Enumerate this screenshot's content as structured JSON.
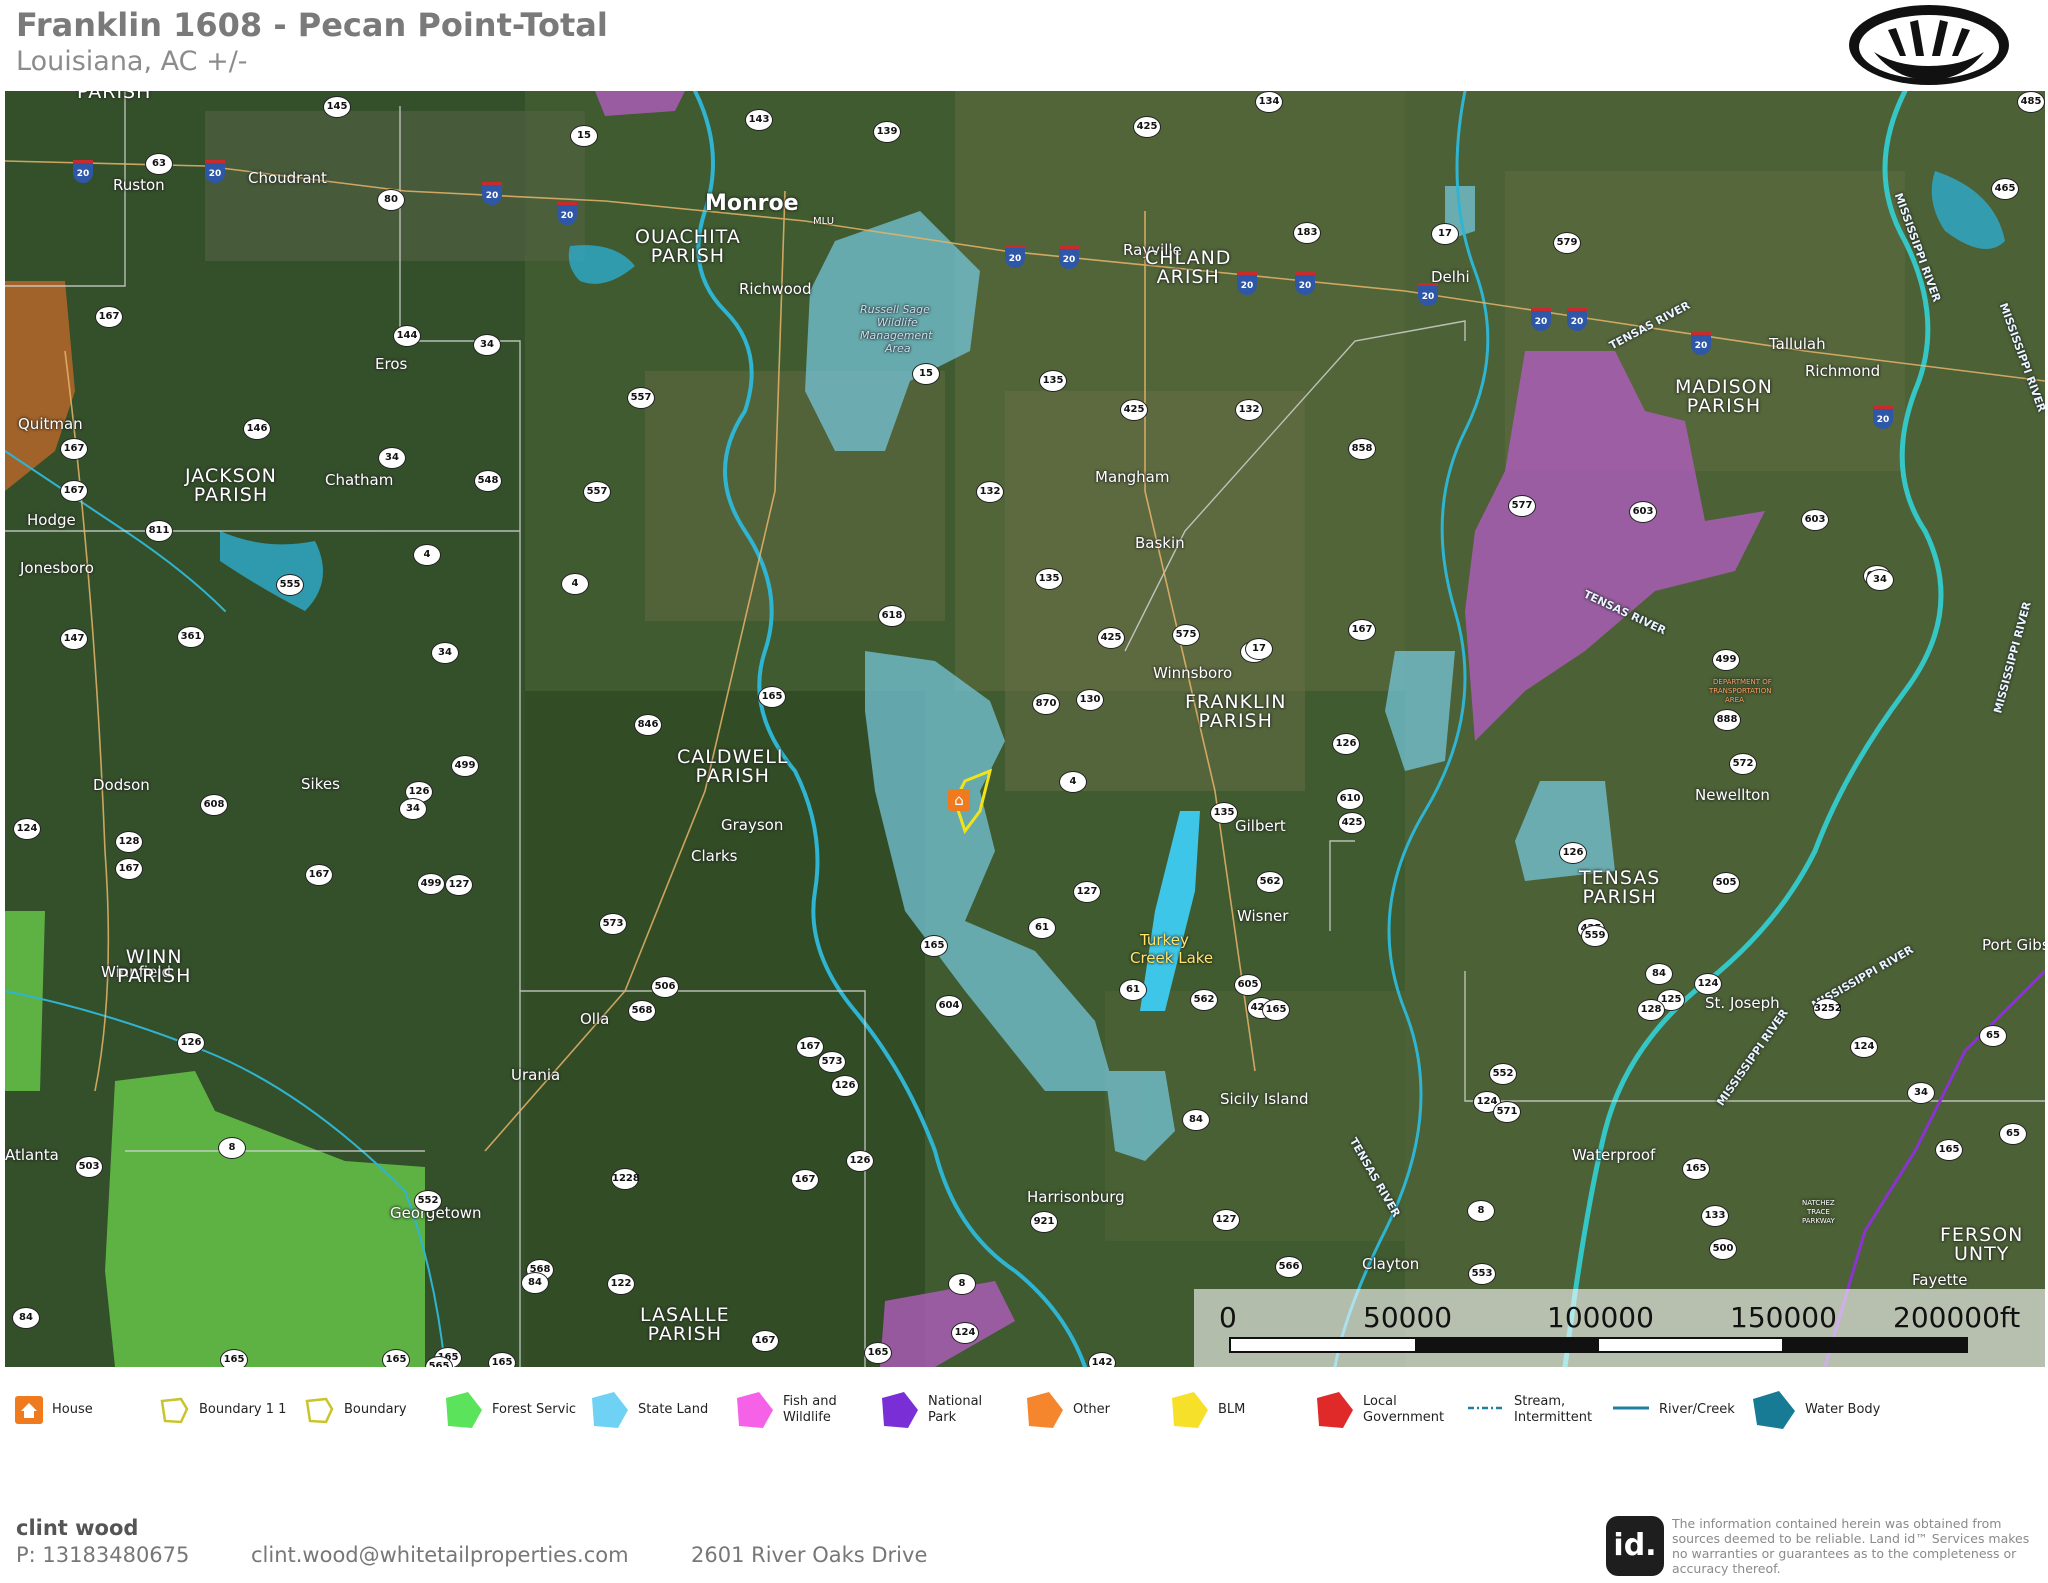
{
  "header": {
    "title": "Franklin 1608 - Pecan Point-Total",
    "subtitle": "Louisiana,  AC +/-"
  },
  "logo": {
    "icon": "bear-paw-logo-icon"
  },
  "map": {
    "property_marker": {
      "icon": "house-icon"
    },
    "cities": [
      {
        "name": "Ruston",
        "size": "small"
      },
      {
        "name": "Choudrant",
        "size": "small"
      },
      {
        "name": "Monroe",
        "size": "big"
      },
      {
        "name": "Richwood",
        "size": "small"
      },
      {
        "name": "Rayville",
        "size": "small"
      },
      {
        "name": "Delhi",
        "size": "small"
      },
      {
        "name": "Tallulah",
        "size": "small"
      },
      {
        "name": "Richmond",
        "size": "small"
      },
      {
        "name": "Eros",
        "size": "small"
      },
      {
        "name": "Quitman",
        "size": "small"
      },
      {
        "name": "Chatham",
        "size": "small"
      },
      {
        "name": "Hodge",
        "size": "small"
      },
      {
        "name": "Jonesboro",
        "size": "small"
      },
      {
        "name": "Mangham",
        "size": "small"
      },
      {
        "name": "Baskin",
        "size": "small"
      },
      {
        "name": "Winnsboro",
        "size": "small"
      },
      {
        "name": "Dodson",
        "size": "small"
      },
      {
        "name": "Sikes",
        "size": "small"
      },
      {
        "name": "Grayson",
        "size": "small"
      },
      {
        "name": "Clarks",
        "size": "small"
      },
      {
        "name": "Gilbert",
        "size": "small"
      },
      {
        "name": "Newellton",
        "size": "small"
      },
      {
        "name": "Wisner",
        "size": "small"
      },
      {
        "name": "Winnfield",
        "size": "small"
      },
      {
        "name": "Olla",
        "size": "small"
      },
      {
        "name": "Urania",
        "size": "small"
      },
      {
        "name": "St. Joseph",
        "size": "small"
      },
      {
        "name": "Port Gibs",
        "size": "small"
      },
      {
        "name": "Sicily Island",
        "size": "small"
      },
      {
        "name": "Atlanta",
        "size": "small"
      },
      {
        "name": "Waterproof",
        "size": "small"
      },
      {
        "name": "Georgetown",
        "size": "small"
      },
      {
        "name": "Harrisonburg",
        "size": "small"
      },
      {
        "name": "Clayton",
        "size": "small"
      },
      {
        "name": "Fayette",
        "size": "small"
      }
    ],
    "parishes": [
      {
        "line1": "OUACHITA",
        "line2": "PARISH"
      },
      {
        "line1": "CHLAND",
        "line2": "ARISH"
      },
      {
        "line1": "MADISON",
        "line2": "PARISH"
      },
      {
        "line1": "JACKSON",
        "line2": "PARISH"
      },
      {
        "line1": "FRANKLIN",
        "line2": "PARISH"
      },
      {
        "line1": "CALDWELL",
        "line2": "PARISH"
      },
      {
        "line1": "TENSAS",
        "line2": "PARISH"
      },
      {
        "line1": "WINN",
        "line2": "PARISH"
      },
      {
        "line1": "LASALLE",
        "line2": "PARISH"
      },
      {
        "line1": "FERSON",
        "line2": "UNTY"
      },
      {
        "line1": "PARISH",
        "line2": ""
      }
    ],
    "rivers": [
      {
        "name": "TENSAS RIVER"
      },
      {
        "name": "TENSAS RIVER"
      },
      {
        "name": "MISSISSIPPI RIVER"
      },
      {
        "name": "MISSISSIPPI RIVER"
      },
      {
        "name": "MISSISSIPPI RIVER"
      },
      {
        "name": "MISSISSIPPI RIVER"
      },
      {
        "name": "MISSISSIPPI RIVER"
      },
      {
        "name": "TENSAS RIVER"
      }
    ],
    "water_bodies": [
      {
        "name": "Turkey"
      },
      {
        "name": "Creek Lake"
      }
    ],
    "small_labels": [
      {
        "text": "MLU"
      },
      {
        "text": "Russell Sage"
      },
      {
        "text": "Wildlife"
      },
      {
        "text": "Management"
      },
      {
        "text": "Area"
      },
      {
        "text": "DEPARTMENT OF"
      },
      {
        "text": "TRANSPORTATION"
      },
      {
        "text": "AREA"
      },
      {
        "text": "NATCHEZ"
      },
      {
        "text": "TRACE"
      },
      {
        "text": "PARKWAY"
      }
    ],
    "route_shields": [
      "145",
      "15",
      "143",
      "139",
      "425",
      "134",
      "485",
      "63",
      "80",
      "183",
      "465",
      "579",
      "17",
      "167",
      "144",
      "34",
      "557",
      "15",
      "135",
      "425",
      "132",
      "146",
      "34",
      "548",
      "557",
      "132",
      "858",
      "577",
      "603",
      "167",
      "167",
      "811",
      "4",
      "4",
      "135",
      "17",
      "603",
      "603",
      "34",
      "555",
      "167",
      "147",
      "361",
      "618",
      "425",
      "575",
      "499",
      "34",
      "165",
      "870",
      "130",
      "17",
      "888",
      "846",
      "126",
      "499",
      "610",
      "126",
      "4",
      "135",
      "425",
      "572",
      "608",
      "34",
      "126",
      "128",
      "167",
      "167",
      "499",
      "127",
      "127",
      "562",
      "425",
      "573",
      "506",
      "165",
      "559",
      "125",
      "604",
      "124",
      "605",
      "84",
      "562",
      "425",
      "128",
      "3252",
      "568",
      "165",
      "124",
      "126",
      "552",
      "167",
      "573",
      "124",
      "126",
      "571",
      "34",
      "8",
      "552",
      "84",
      "165",
      "503",
      "126",
      "1228",
      "167",
      "165",
      "127",
      "921",
      "8",
      "566",
      "568",
      "553",
      "500",
      "84",
      "122",
      "8",
      "84",
      "124",
      "167",
      "165",
      "165",
      "165",
      "165",
      "165",
      "4",
      "565",
      "142",
      "61",
      "61",
      "65",
      "65",
      "505",
      "133",
      "124"
    ],
    "interstate_shields": [
      "20",
      "20",
      "20",
      "20",
      "20",
      "20",
      "20",
      "20",
      "20",
      "20",
      "20",
      "20",
      "20"
    ]
  },
  "scale": {
    "labels": [
      "0",
      "50000",
      "100000",
      "150000",
      "200000ft"
    ]
  },
  "legend": [
    {
      "label": "House",
      "icon": "house-icon",
      "color": "#f07a1e"
    },
    {
      "label": "Boundary 1 1",
      "icon": "boundary-icon",
      "color": "#d8d43a"
    },
    {
      "label": "Boundary",
      "icon": "boundary-icon",
      "color": "#d8d43a"
    },
    {
      "label": "Forest Servic",
      "icon": "forest-service-icon",
      "color": "#5be35b"
    },
    {
      "label": "State Land",
      "icon": "state-land-icon",
      "color": "#6fd2f5"
    },
    {
      "label": "Fish and\nWildlife",
      "icon": "fish-wildlife-icon",
      "color": "#f562e8"
    },
    {
      "label": "National Park",
      "icon": "national-park-icon",
      "color": "#7a2fd6"
    },
    {
      "label": "Other",
      "icon": "other-icon",
      "color": "#f5862e"
    },
    {
      "label": "BLM",
      "icon": "blm-icon",
      "color": "#f7e02a"
    },
    {
      "label": "Local\nGovernment",
      "icon": "local-government-icon",
      "color": "#e02a2a"
    },
    {
      "label": "Stream,\nIntermittent",
      "icon": "stream-intermittent-icon",
      "color": "#1f7fa0"
    },
    {
      "label": "River/Creek",
      "icon": "river-creek-icon",
      "color": "#1f7fa0"
    },
    {
      "label": "Water Body",
      "icon": "water-body-icon",
      "color": "#177b96"
    }
  ],
  "footer": {
    "name": "clint wood",
    "phone": "P: 13183480675",
    "email": "clint.wood@whitetailproperties.com",
    "address": "2601 River Oaks Drive",
    "id_logo": "id.",
    "disclaimer": "The information contained herein was obtained from sources deemed to be reliable.\n Land id™ Services makes no warranties or guarantees as to the completeness or accuracy thereof."
  }
}
